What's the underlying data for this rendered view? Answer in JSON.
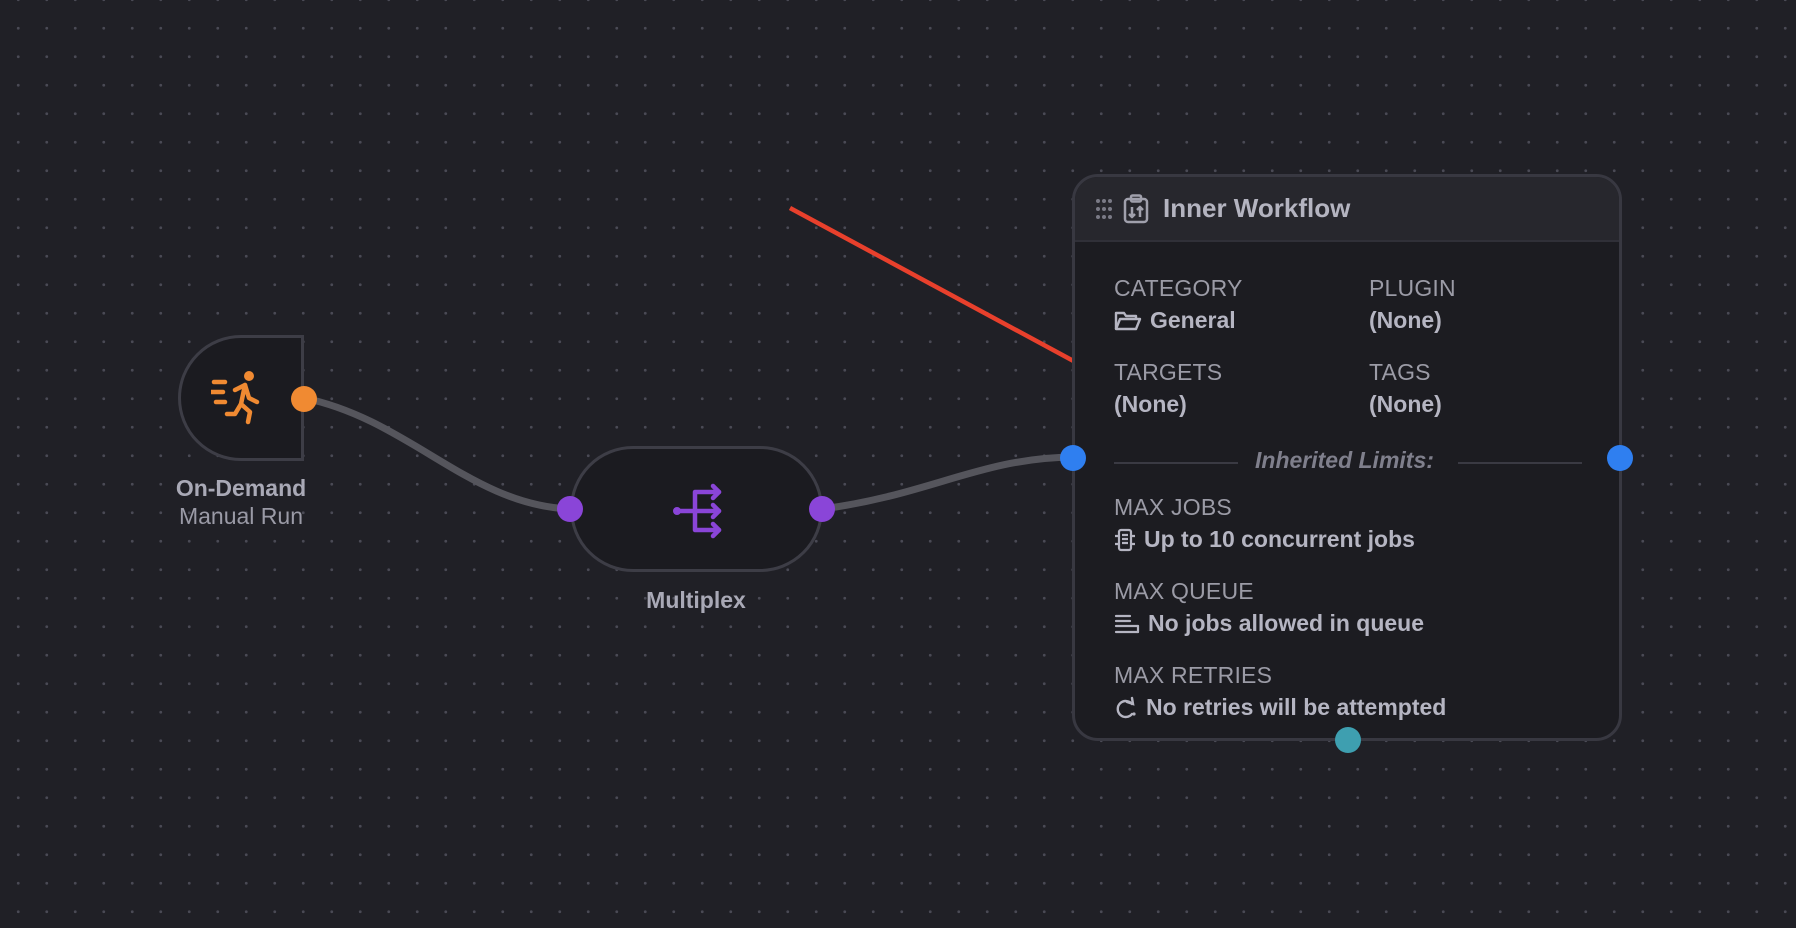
{
  "trigger": {
    "title": "On-Demand",
    "subtitle": "Manual Run",
    "icon": "running-person-icon",
    "color": "#f08a32"
  },
  "multiplex": {
    "title": "Multiplex",
    "icon": "split-arrows-icon",
    "color": "#8a45d8"
  },
  "workflow": {
    "title": "Inner Workflow",
    "title_icon": "clipboard-icon",
    "category_label": "CATEGORY",
    "category_value": "General",
    "plugin_label": "PLUGIN",
    "plugin_value": "(None)",
    "targets_label": "TARGETS",
    "targets_value": "(None)",
    "tags_label": "TAGS",
    "tags_value": "(None)",
    "inherited_limits": "Inherited Limits:",
    "max_jobs_label": "MAX JOBS",
    "max_jobs_value": "Up to 10 concurrent jobs",
    "max_queue_label": "MAX QUEUE",
    "max_queue_value": "No jobs allowed in queue",
    "max_retries_label": "MAX RETRIES",
    "max_retries_value": "No retries will be attempted"
  },
  "colors": {
    "background": "#202026",
    "edge": "#55555c",
    "annotation_arrow": "#e8402c",
    "port_blue": "#2f7ff0",
    "port_teal": "#3e9fb0"
  }
}
